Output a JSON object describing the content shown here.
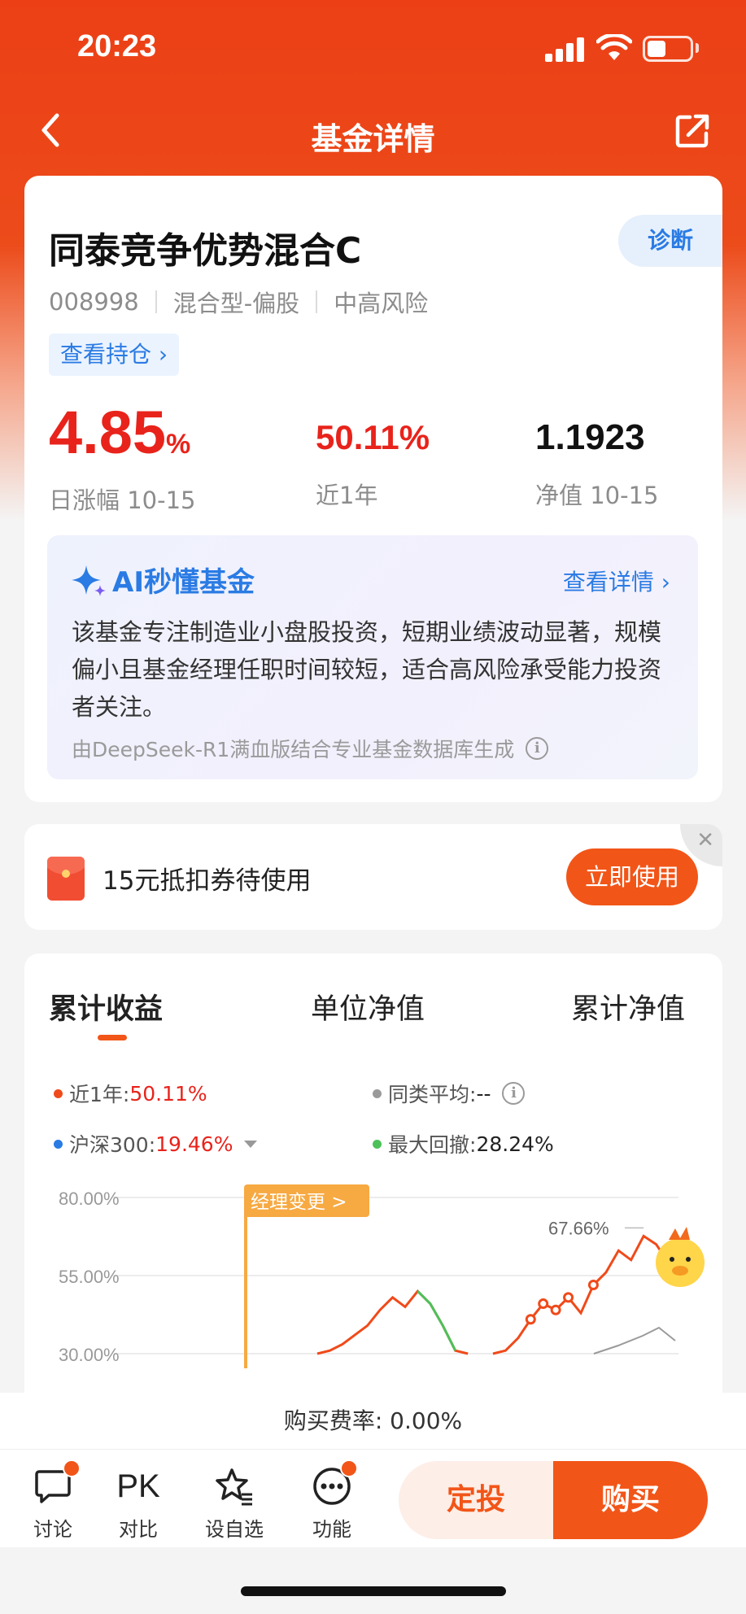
{
  "status_bar": {
    "time": "20:23"
  },
  "nav": {
    "title": "基金详情"
  },
  "fund": {
    "name": "同泰竞争优势混合C",
    "diagnose_label": "诊断",
    "code": "008998",
    "type": "混合型-偏股",
    "risk": "中高风险",
    "holdings_label": "查看持仓 ›",
    "daily_change": "4.85",
    "daily_change_unit": "%",
    "daily_change_label": "日涨幅 10-15",
    "year_return": "50.11%",
    "year_return_label": "近1年",
    "nav_value": "1.1923",
    "nav_label": "净值 10-15"
  },
  "ai": {
    "title": "AI秒懂基金",
    "detail_link": "查看详情 ›",
    "summary": "该基金专注制造业小盘股投资，短期业绩波动显著，规模偏小且基金经理任职时间较短，适合高风险承受能力投资者关注。",
    "source": "由DeepSeek-R1满血版结合专业基金数据库生成"
  },
  "coupon": {
    "text": "15元抵扣券待使用",
    "button": "立即使用",
    "close": "✕"
  },
  "chart_tabs": [
    "累计收益",
    "单位净值",
    "累计净值"
  ],
  "legend": {
    "year_label": "近1年: ",
    "year_value": "50.11%",
    "avg_label": "同类平均: ",
    "avg_value": "--",
    "index_label": "沪深300: ",
    "index_value": "19.46%",
    "drawdown_label": "最大回撤: ",
    "drawdown_value": "28.24%"
  },
  "colors": {
    "fund_line": "#f04a1a",
    "index_line": "#2a7be4",
    "avg_line": "#9a9a9a",
    "drawdown": "#4cc15a",
    "accent": "#f25518"
  },
  "chart_data": {
    "type": "line",
    "y_ticks": [
      "80.00%",
      "55.00%",
      "30.00%"
    ],
    "ylim": [
      30,
      80
    ],
    "annotations": {
      "manager_change": "经理变更 >",
      "peak": "67.66%"
    },
    "series": [
      {
        "name": "近1年",
        "values": [
          30,
          31,
          33,
          36,
          39,
          44,
          48,
          45,
          50,
          46,
          39,
          31,
          30,
          30,
          30,
          31,
          35,
          41,
          46,
          44,
          48,
          43,
          52,
          56,
          63,
          60,
          67.66,
          65,
          59
        ]
      }
    ]
  },
  "fee": {
    "text": "购买费率: 0.00%"
  },
  "bottom_nav": {
    "discuss": "讨论",
    "compare_icon": "PK",
    "compare": "对比",
    "watchlist": "设自选",
    "functions": "功能",
    "dingtou": "定投",
    "buy": "购买"
  }
}
